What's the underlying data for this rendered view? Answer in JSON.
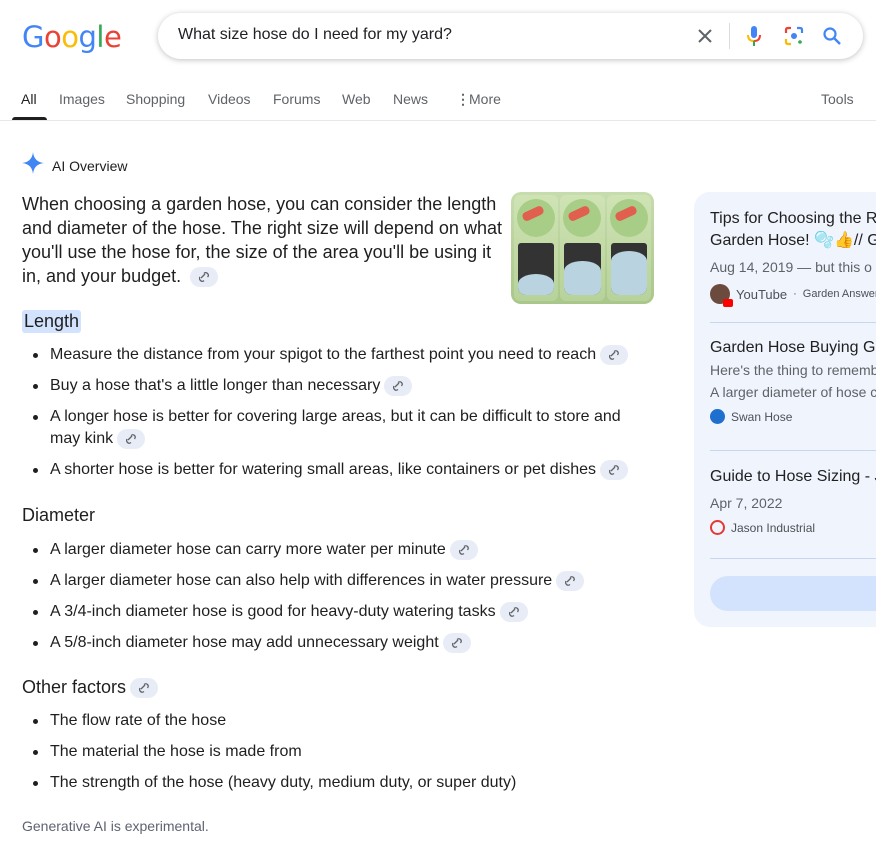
{
  "logo": {
    "text": "Google",
    "letters": [
      "G",
      "o",
      "o",
      "g",
      "l",
      "e"
    ],
    "colors": [
      "#4285f4",
      "#ea4335",
      "#fbbc05",
      "#4285f4",
      "#34a853",
      "#ea4335"
    ]
  },
  "search": {
    "query": "What size hose do I need for my yard?",
    "icons": [
      "clear-icon",
      "microphone-icon",
      "lens-icon",
      "search-icon"
    ]
  },
  "tabs": [
    {
      "label": "All",
      "active": true
    },
    {
      "label": "Images"
    },
    {
      "label": "Shopping"
    },
    {
      "label": "Videos"
    },
    {
      "label": "Forums"
    },
    {
      "label": "Web"
    },
    {
      "label": "News"
    },
    {
      "label": "More"
    }
  ],
  "tools_label": "Tools",
  "ai_overview": {
    "title": "AI Overview",
    "intro": "When choosing a garden hose, you can consider the length and diameter of the hose. The right size will depend on what you'll use the hose for, the size of the area you'll be using it in, and your budget.",
    "sections": [
      {
        "heading": "Length",
        "items": [
          "Measure the distance from your spigot to the farthest point you need to reach",
          "Buy a hose that's a little longer than necessary",
          "A longer hose is better for covering large areas, but it can be difficult to store and may kink",
          "A shorter hose is better for watering small areas, like containers or pet dishes"
        ]
      },
      {
        "heading": "Diameter",
        "items": [
          "A larger diameter hose can carry more water per minute",
          "A larger diameter hose can also help with differences in water pressure",
          "A 3/4-inch diameter hose is good for heavy-duty watering tasks",
          "A 5/8-inch diameter hose may add unnecessary weight"
        ]
      },
      {
        "heading": "Other factors",
        "items": [
          "The flow rate of the hose",
          "The material the hose is made from",
          "The strength of the hose (heavy duty, medium duty, or super duty)"
        ]
      }
    ],
    "footnote": "Generative AI is experimental."
  },
  "sources": [
    {
      "title_line1": "Tips for Choosing the R",
      "title_line2": "Garden Hose! 🫧👍// G",
      "meta": "Aug 14, 2019 — but this o",
      "site": "YouTube",
      "author": "Garden Answer"
    },
    {
      "title_line1": "Garden Hose Buying Gu",
      "snippet1": "Here's the thing to rememb",
      "snippet2": "A larger diameter of hose c",
      "site": "Swan Hose"
    },
    {
      "title_line1": "Guide to Hose Sizing - J",
      "meta": "Apr 7, 2022",
      "site": "Jason Industrial"
    }
  ],
  "colors": {
    "accent": "#1a73e8",
    "chip_bg": "#e8ecf7",
    "sources_bg": "#f0f4fd",
    "highlight": "#d3e3fd"
  }
}
